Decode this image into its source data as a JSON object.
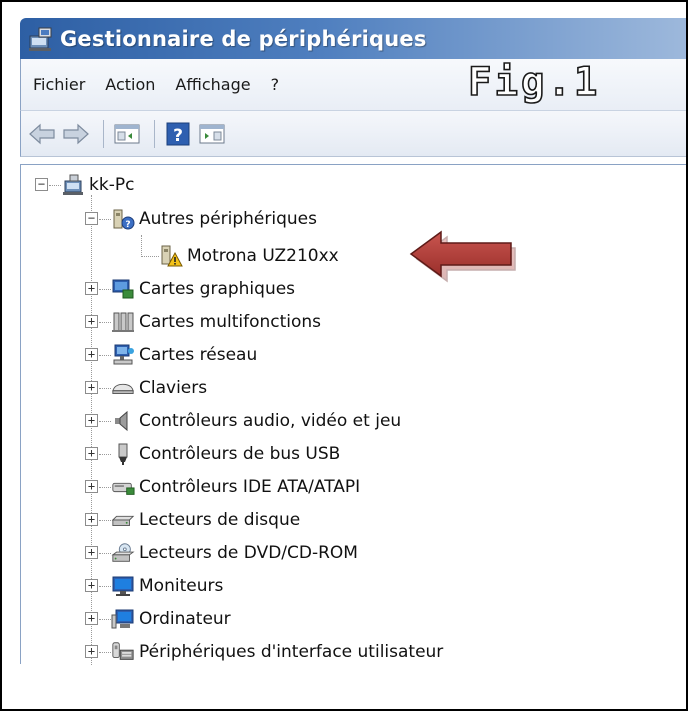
{
  "window": {
    "title": "Gestionnaire de périphériques",
    "figure_label": "Fig.1"
  },
  "menu": {
    "items": [
      "Fichier",
      "Action",
      "Affichage",
      "?"
    ]
  },
  "toolbar": {
    "buttons": [
      "back-icon",
      "forward-icon",
      "console-tree-icon",
      "help-icon",
      "action-pane-icon"
    ]
  },
  "tree": {
    "root": "kk-Pc",
    "nodes": [
      {
        "label": "Autres périphériques",
        "icon": "unknown-device-icon",
        "expanded": true
      },
      {
        "label": "Motrona UZ210xx",
        "icon": "warning-device-icon",
        "child": true
      },
      {
        "label": "Cartes graphiques",
        "icon": "display-adapter-icon"
      },
      {
        "label": "Cartes multifonctions",
        "icon": "multifunction-icon"
      },
      {
        "label": "Cartes réseau",
        "icon": "network-adapter-icon"
      },
      {
        "label": "Claviers",
        "icon": "keyboard-icon"
      },
      {
        "label": "Contrôleurs audio, vidéo et jeu",
        "icon": "speaker-icon"
      },
      {
        "label": "Contrôleurs de bus USB",
        "icon": "usb-icon"
      },
      {
        "label": "Contrôleurs IDE ATA/ATAPI",
        "icon": "ide-controller-icon"
      },
      {
        "label": "Lecteurs de disque",
        "icon": "disk-drive-icon"
      },
      {
        "label": "Lecteurs de DVD/CD-ROM",
        "icon": "dvd-drive-icon"
      },
      {
        "label": "Moniteurs",
        "icon": "monitor-icon"
      },
      {
        "label": "Ordinateur",
        "icon": "computer-icon"
      },
      {
        "label": "Périphériques d'interface utilisateur",
        "icon": "hid-icon"
      }
    ]
  },
  "colors": {
    "titlebar_start": "#2d5fa4",
    "titlebar_end": "#9eb9dc",
    "arrow": "#b5403c"
  }
}
